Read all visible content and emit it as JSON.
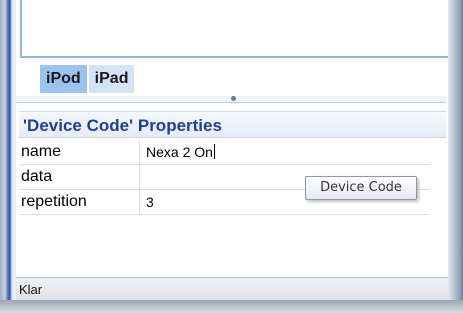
{
  "tabs": [
    {
      "label": "iPod",
      "active": true
    },
    {
      "label": "iPad",
      "active": false
    }
  ],
  "properties": {
    "title": "'Device Code' Properties",
    "rows": [
      {
        "name": "name",
        "value": "Nexa 2 On"
      },
      {
        "name": "data",
        "value": ""
      },
      {
        "name": "repetition",
        "value": "3"
      }
    ]
  },
  "tooltip": {
    "text": "Device Code"
  },
  "status_bar": {
    "text": "Klar"
  },
  "colors": {
    "accent": "#1f3f8f",
    "tab_active": "#9bc3f0",
    "tab_inactive": "#d4e3f7",
    "panel_border": "#8fb4e6"
  }
}
